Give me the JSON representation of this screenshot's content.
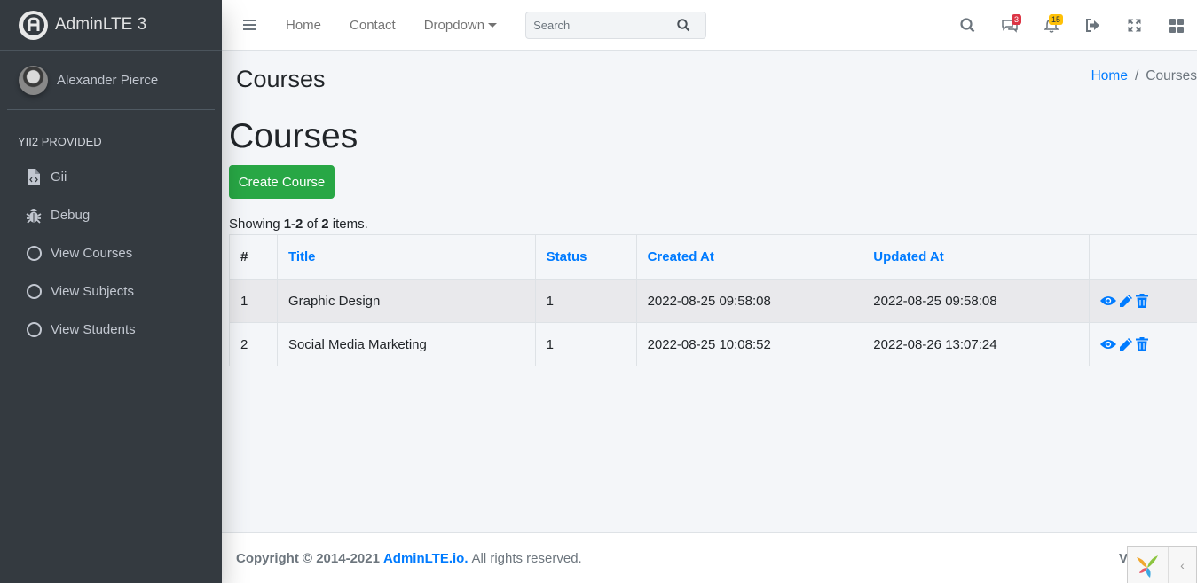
{
  "brand": {
    "name": "AdminLTE 3"
  },
  "user": {
    "name": "Alexander Pierce"
  },
  "sidebar": {
    "header": "Yii2 PROVIDED",
    "items": [
      {
        "label": "Gii",
        "icon": "file-code-icon"
      },
      {
        "label": "Debug",
        "icon": "bug-icon"
      },
      {
        "label": "View Courses",
        "icon": "circle-icon"
      },
      {
        "label": "View Subjects",
        "icon": "circle-icon"
      },
      {
        "label": "View Students",
        "icon": "circle-icon"
      }
    ]
  },
  "navbar": {
    "links": [
      "Home",
      "Contact",
      "Dropdown"
    ],
    "search_placeholder": "Search",
    "messages_count": "3",
    "notifications_count": "15"
  },
  "content": {
    "header_title": "Courses",
    "breadcrumb": {
      "home": "Home",
      "active": "Courses"
    },
    "page_title": "Courses",
    "create_button": "Create Course",
    "summary": {
      "prefix": "Showing",
      "range": "1-2",
      "of": "of",
      "total": "2",
      "suffix": "items."
    }
  },
  "table": {
    "columns": [
      "#",
      "Title",
      "Status",
      "Created At",
      "Updated At",
      ""
    ],
    "rows": [
      {
        "num": "1",
        "title": "Graphic Design",
        "status": "1",
        "created": "2022-08-25 09:58:08",
        "updated": "2022-08-25 09:58:08"
      },
      {
        "num": "2",
        "title": "Social Media Marketing",
        "status": "1",
        "created": "2022-08-25 10:08:52",
        "updated": "2022-08-26 13:07:24"
      }
    ]
  },
  "footer": {
    "copyright": "Copyright © 2014-2021",
    "link": "AdminLTE.io.",
    "rights": "All rights reserved.",
    "version": "V"
  },
  "colors": {
    "primary": "#007bff",
    "success": "#28a745",
    "sidebar": "#343a40",
    "danger": "#dc3545",
    "warning": "#ffc107"
  }
}
